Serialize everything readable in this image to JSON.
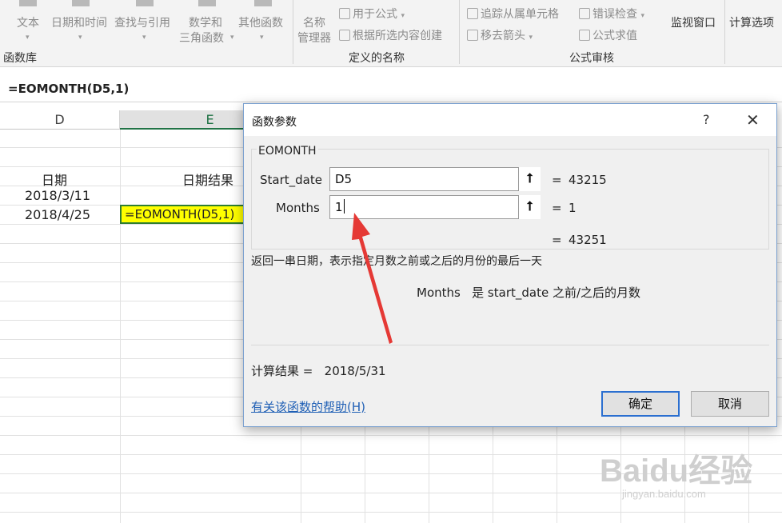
{
  "ribbon": {
    "items": [
      {
        "label": "文本",
        "id": "text"
      },
      {
        "label": "日期和时间",
        "id": "datetime"
      },
      {
        "label": "查找与引用",
        "id": "lookup"
      },
      {
        "label": "数学和",
        "id": "math1"
      },
      {
        "label": "三角函数",
        "id": "math2"
      },
      {
        "label": "其他函数",
        "id": "other"
      },
      {
        "label": "名称",
        "id": "name1"
      },
      {
        "label": "管理器",
        "id": "name2"
      },
      {
        "label": "用于公式",
        "id": "use_in_formula"
      },
      {
        "label": "根据所选内容创建",
        "id": "create_from_sel"
      },
      {
        "label": "追踪从属单元格",
        "id": "trace_dependents"
      },
      {
        "label": "错误检查",
        "id": "error_check"
      },
      {
        "label": "移去箭头",
        "id": "remove_arrows"
      },
      {
        "label": "公式求值",
        "id": "evaluate_formula"
      },
      {
        "label": "监视窗口",
        "id": "watch_window"
      },
      {
        "label": "计算选项",
        "id": "calc_options"
      }
    ],
    "groups": {
      "function_library": "函数库",
      "defined_names": "定义的名称",
      "formula_auditing": "公式审核"
    }
  },
  "formula_bar": {
    "value": "=EOMONTH(D5,1)"
  },
  "sheet": {
    "columns": {
      "d": "D",
      "e": "E"
    },
    "cells": {
      "d_header": "日期",
      "e_header": "日期结果",
      "d4": "2018/3/11",
      "d5": "2018/4/25",
      "e5": "=EOMONTH(D5,1)"
    }
  },
  "dialog": {
    "title": "函数参数",
    "help_glyph": "?",
    "close_glyph": "✕",
    "function_name": "EOMONTH",
    "args": [
      {
        "label": "Start_date",
        "value": "D5",
        "result": "43215"
      },
      {
        "label": "Months",
        "value": "1",
        "result": "1"
      }
    ],
    "equals": "=",
    "overall_result": "43251",
    "description": "返回一串日期，表示指定月数之前或之后的月份的最后一天",
    "param_name": "Months",
    "param_description": "是 start_date 之前/之后的月数",
    "calc_result_label": "计算结果 =",
    "calc_result_value": "2018/5/31",
    "help_link": "有关该函数的帮助(H)",
    "ok_label": "确定",
    "cancel_label": "取消"
  },
  "watermark": {
    "brand": "Baidu经验",
    "url": "jingyan.baidu.com"
  },
  "colors": {
    "accent_green": "#217346",
    "highlight_yellow": "#ffff00",
    "annotation_red": "#e53935",
    "link_blue": "#1f5fb5"
  }
}
